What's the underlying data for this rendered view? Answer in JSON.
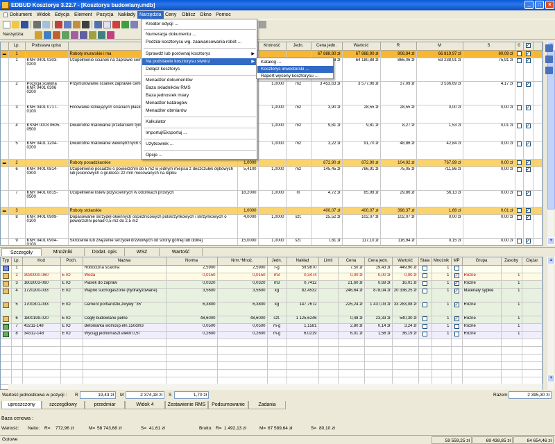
{
  "window": {
    "title": "EDBUD Kosztorys 3.22.7 - [Kosztorys budowlany.mdb]"
  },
  "menu": [
    "Dokument",
    "Widok",
    "Edycja",
    "Element",
    "Pozycja",
    "Nakłady",
    "Narzędzia",
    "Ceny",
    "Oblicz",
    "Okno",
    "Pomoc"
  ],
  "toolbar2_label": "Narzędzia:",
  "dropdown": {
    "items": [
      "Kreator edycji ...",
      "Numeracja dokumentu ...",
      "Podział kosztorysu wg. zaawansowania robót ...",
      "Sprawdź lub porównaj kosztorys",
      "Na podstawie kosztorysu stwórz",
      "Dołącz kosztorys",
      "Menadżer dokumentów",
      "Baza składników RMS",
      "Baza jednostek miary",
      "Menadżer katalogów",
      "Menadżer obmiarów",
      "Kalkulator",
      "Importuj/Eksportuj ...",
      "Użytkownik ...",
      "Opcje ..."
    ]
  },
  "submenu": {
    "items": [
      "Katalog ...",
      "Kosztorys inwestorski ...",
      "Raport wyceny kosztorysu ..."
    ]
  },
  "top_headers": [
    "Lp.",
    "Podstawa opisu",
    "Opis",
    "Ilość",
    "Krotność",
    "Jedn.",
    "Cena jedn.",
    "Wartość",
    "R",
    "M",
    "S"
  ],
  "top_rows": [
    {
      "type": "sec",
      "lp": "1",
      "desc": "Roboty murarskie i ma",
      "ilosc": "",
      "krot": "",
      "jedn": "",
      "cena": "67 888,90 zł",
      "wart": "67 888,90 zł",
      "r": "908,84 zł",
      "m": "66 819,97 zł",
      "s": "80,09 zł"
    },
    {
      "type": "row",
      "lp": "1",
      "base": "KNR 0401 0303-0200",
      "desc": "Uzupełnienie ścianek na zaprawie cementow grubości 1/2 cegły",
      "ilosc": "",
      "krot": "",
      "jedn": "",
      "cena": "4,08 zł",
      "wart": "64 180,88 zł",
      "r": "866,06 zł",
      "m": "63 238,91 zł",
      "s": "75,91 zł"
    },
    {
      "type": "row",
      "lp": "2",
      "base": "Pozycja scalona KNR 0401 0306 0200",
      "desc": "Przymurowanie ścianek zaprawie cementowo- grubości 1/2 cegły",
      "ilosc": "360",
      "krot": "1,0000",
      "jedn": "m2",
      "cena": "3 453,63 zł",
      "wart": "3 577,96 zł",
      "r": "37,09 zł",
      "m": "3 536,69 zł",
      "s": "4,17 zł"
    },
    {
      "type": "row",
      "lp": "3",
      "base": "KNR 0401 0717-0100",
      "desc": "Filcowanie istniejących ścianach płaskich o",
      "ilosc": "230",
      "krot": "1,0000",
      "jedn": "m2",
      "cena": "3,90 zł",
      "wart": "28,55 zł",
      "r": "28,55 zł",
      "m": "0,00 zł",
      "s": "0,00 zł"
    },
    {
      "type": "row",
      "lp": "4",
      "base": "KSNR 0003 0605-0500",
      "desc": "Dwukrotne malowanie przetarciem tynków (w",
      "ilosc": "000",
      "krot": "1,0000",
      "jedn": "m2",
      "cena": "9,81 zł",
      "wart": "9,81 zł",
      "r": "8,27 zł",
      "m": "1,53 zł",
      "s": "0,01 zł"
    },
    {
      "type": "row",
      "lp": "5",
      "base": "KNR 0401 1204-0200",
      "desc": "Dwukrotne malowanie wewnętrznych ścian",
      "ilosc": "4400",
      "krot": "1,0000",
      "jedn": "m2",
      "cena": "3,22 zł",
      "wart": "91,70 zł",
      "r": "48,86 zł",
      "m": "42,84 zł",
      "s": "0,00 zł"
    },
    {
      "type": "sec",
      "lp": "2",
      "desc": "Roboty posadzkarskie",
      "ilosc": "1,0000",
      "krot": "",
      "jedn": "",
      "cena": "872,90 zł",
      "wart": "872,90 zł",
      "r": "104,92 zł",
      "m": "767,99 zł",
      "s": "0,00 zł"
    },
    {
      "type": "row",
      "lp": "6",
      "base": "KNR 0401 0814-0300",
      "desc": "Uzupełnienie posadzki o powierzchni do 5 m2 w jednym miejscu z deszczułek dębowych lub jesionowych o grubości 22 mm mocowanych na lepiku",
      "ilosc": "5,4100",
      "krot": "1,0000",
      "jedn": "m2",
      "cena": "145,45 zł",
      "wart": "786,91 zł",
      "r": "75,05 zł",
      "m": "711,86 zł",
      "s": "0,00 zł"
    },
    {
      "type": "row",
      "lp": "7",
      "base": "KNR 0401 0815-0500",
      "desc": "Uzupełnienie listew przyściennych w odcinkach prostych",
      "ilosc": "18,2000",
      "krot": "1,0000",
      "jedn": "m",
      "cena": "4,72 zł",
      "wart": "85,99 zł",
      "r": "29,86 zł",
      "m": "56,13 zł",
      "s": "0,00 zł"
    },
    {
      "type": "sec",
      "lp": "3",
      "desc": "Roboty stolarskie",
      "ilosc": "1,0000",
      "krot": "",
      "jedn": "",
      "cena": "400,07 zł",
      "wart": "400,07 zł",
      "r": "398,37 zł",
      "m": "1,68 zł",
      "s": "0,01 zł"
    },
    {
      "type": "row",
      "lp": "8",
      "base": "KNR 0401 0909-0100",
      "desc": "Dopasowanie skrzydeł okiennych oscieżnicowych polskrzynkowych i skrzynkowych o powierzchni ponad 0,5 m2 do 2,5 m2",
      "ilosc": "4,0000",
      "krot": "1,0000",
      "jedn": "szt.",
      "cena": "25,52 zł",
      "wart": "102,07 zł",
      "r": "102,07 zł",
      "m": "0,00 zł",
      "s": "0,00 zł"
    },
    {
      "type": "row",
      "lp": "9",
      "base": "KNR 0401 0904-0100",
      "desc": "Skrócenie lub zwężenie skrzydeł drzwiowych od strony górnej lub dolnej",
      "ilosc": "15,0000",
      "krot": "1,0000",
      "jedn": "szt.",
      "cena": "7,81 zł",
      "wart": "117,10 zł",
      "r": "116,94 zł",
      "m": "0,15 zł",
      "s": "0,00 zł"
    }
  ],
  "mid_tabs": [
    "Szczegóły",
    "Mnożniki",
    "Dodat. opis",
    "WSZ",
    "Wartość"
  ],
  "bot_headers": [
    "Typ",
    "Lp.",
    "Kod",
    "Poch.",
    "Nazwa",
    "Norma",
    "Nrm.*Mnoż.",
    "Jedn.",
    "Nakład",
    "Limit",
    "Cena",
    "Cena jedn.",
    "Wartość",
    "Stała",
    "Mnożnik",
    "MP",
    "Grupa",
    "Zasoby",
    "Ciężar"
  ],
  "bot_rows": [
    {
      "lp": "1",
      "kod": "",
      "poch": "",
      "name": "Robocizna scalona",
      "norma": "2,5900",
      "nrm": "2,5900",
      "jedn": "r-g",
      "naklad": "59,9870",
      "limit": "",
      "cena": "7,50 zł",
      "cjedn": "19,43 zł",
      "wart": "449,90 zł",
      "mn": "1",
      "mp": "",
      "grupa": "",
      "zas": "",
      "cls": "b1"
    },
    {
      "lp": "2",
      "kod": "3930000-060",
      "poch": "ETO",
      "name": "Woda",
      "norma": "0,0150",
      "nrm": "0,0150",
      "jedn": "m3",
      "naklad": "0,3474",
      "limit": "",
      "cena": "0,00 zł",
      "cjedn": "0,00 zł",
      "wart": "0,00 zł",
      "mn": "1",
      "mp": "chk",
      "grupa": "Różne",
      "zas": "1",
      "cls": "yel red"
    },
    {
      "lp": "3",
      "kod": "1602003-060",
      "poch": "ETO",
      "name": "Piasek do zapraw",
      "norma": "0,0320",
      "nrm": "0,0320",
      "jedn": "m3",
      "naklad": "0,7412",
      "limit": "",
      "cena": "21,60 zł",
      "cjedn": "0,69 zł",
      "wart": "16,01 zł",
      "mn": "1",
      "mp": "chk",
      "grupa": "Różne",
      "zas": "1",
      "cls": "b2"
    },
    {
      "lp": "4",
      "kod": "1720200-033",
      "poch": "ETO",
      "name": "Wapno suchogaszone (hydratyzowane)",
      "norma": "3,5600",
      "nrm": "3,5600",
      "jedn": "kg",
      "naklad": "82,4532",
      "limit": "",
      "cena": "246,64 zł",
      "cjedn": "878,04 zł",
      "wart": "20 336,25 zł",
      "mn": "1",
      "mp": "chk",
      "grupa": "Materiały sypkie",
      "zas": "1",
      "cls": "b2"
    },
    {
      "lp": "5",
      "kod": "1700301-033",
      "poch": "ETO",
      "name": "Cement portlandzki,zwykły \"35\"",
      "norma": "6,3800",
      "nrm": "6,3800",
      "jedn": "kg",
      "naklad": "147,7672",
      "limit": "",
      "cena": "225,24 zł",
      "cjedn": "1 437,03 zł",
      "wart": "33 283,08 zł",
      "mn": "1",
      "mp": "chk",
      "grupa": "Różne",
      "zas": "1",
      "cls": "b2"
    },
    {
      "lp": "6",
      "kod": "1800199-020",
      "poch": "ETO",
      "name": "Cegły budowlane pełne",
      "norma": "48,6000",
      "nrm": "48,6000",
      "jedn": "szt.",
      "naklad": "1 125,6246",
      "limit": "",
      "cena": "0,48 zł",
      "cjedn": "23,33 zł",
      "wart": "540,30 zł",
      "mn": "1",
      "mp": "chk",
      "grupa": "Różne",
      "zas": "1",
      "cls": "b2"
    },
    {
      "lp": "7",
      "kod": "43211-148",
      "poch": "ETO",
      "name": "Betoniarka wolnosp.eln.150dm3",
      "norma": "0,0500",
      "nrm": "0,0500",
      "jedn": "m-g",
      "naklad": "1,1581",
      "limit": "",
      "cena": "2,80 zł",
      "cjedn": "0,14 zł",
      "wart": "3,24 zł",
      "mn": "1",
      "mp": "",
      "grupa": "Różne",
      "zas": "1",
      "cls": "b3"
    },
    {
      "lp": "8",
      "kod": "34312-148",
      "poch": "ETO",
      "name": "Wyciąg jednomaszt.elektr.0,5t",
      "norma": "0,2600",
      "nrm": "0,2600",
      "jedn": "m-g",
      "naklad": "6,0219",
      "limit": "",
      "cena": "6,01 zł",
      "cjedn": "1,56 zł",
      "wart": "36,19 zł",
      "mn": "1",
      "mp": "",
      "grupa": "Różne",
      "zas": "1",
      "cls": "b3"
    }
  ],
  "stat": {
    "label": "Wartość jednostkowa w pozycji :",
    "r_label": "R",
    "r_val": "19,43 zł",
    "m_label": "M",
    "m_val": "2 374,18 zł",
    "s_label": "S",
    "s_val": "1,70 zł",
    "razem_label": "Razem",
    "razem_val": "2 395,30 zł"
  },
  "bottom_tabs": [
    "uproszczony",
    "szczegółowy",
    "przedmiar",
    "Widok 4",
    "Zestawienie RMS",
    "Podsumowanie",
    "Zadania"
  ],
  "cena_label": "Baza cenowa :",
  "wartosc": {
    "label": "Wartość:",
    "netto": "Netto:",
    "rn": "R=",
    "rv": "772,96 zł",
    "mn": "M=",
    "mv": "58 743,68 zł",
    "sn": "S=",
    "sv": "41,61 zł",
    "brutto": "Brutto:",
    "br": "R=",
    "brv": "1 492,13 zł",
    "bm": "M=",
    "bmv": "67 589,64 zł",
    "bs": "S=",
    "bsv": "80,10 zł"
  },
  "statusbar": {
    "status": "Gotowe",
    "v1": "59 559,25 zł",
    "v2": "69 438,85 zł",
    "v3": "84 654,46 zł"
  }
}
